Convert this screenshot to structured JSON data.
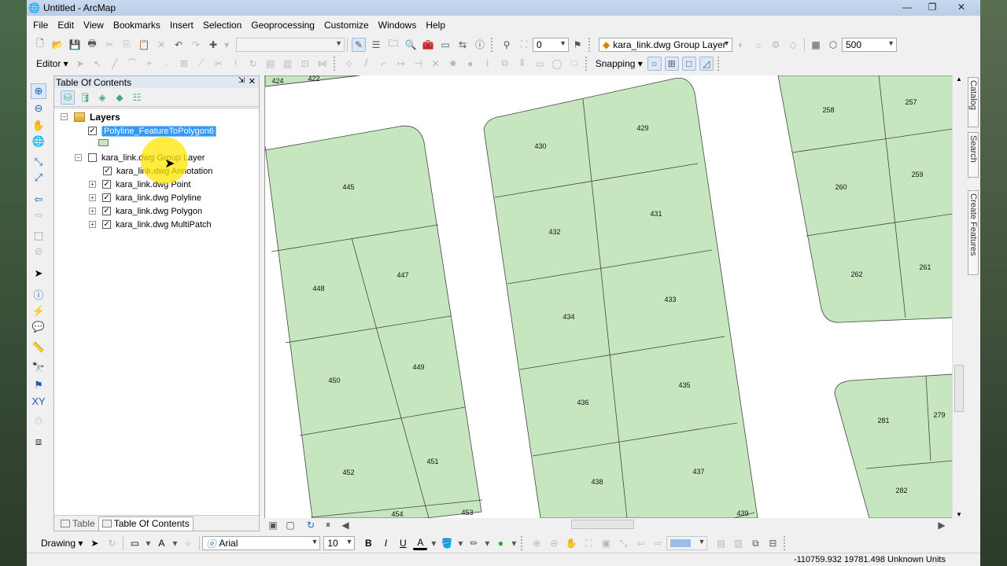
{
  "window": {
    "title": "Untitled - ArcMap",
    "minimize": "—",
    "maximize": "❐",
    "close": "✕"
  },
  "menu": [
    "File",
    "Edit",
    "View",
    "Bookmarks",
    "Insert",
    "Selection",
    "Geoprocessing",
    "Customize",
    "Windows",
    "Help"
  ],
  "toolbar1": {
    "layer_combo_value": "0",
    "active_layer": "kara_link.dwg Group Layer",
    "scale_value": "500"
  },
  "toolbar2": {
    "editor_label": "Editor ▾",
    "snapping_label": "Snapping ▾"
  },
  "toc": {
    "title": "Table Of Contents",
    "pin": "⇲",
    "close": "✕",
    "root_label": "Layers",
    "layers": [
      {
        "label": "Polyline_FeatureToPolygon6",
        "checked": true,
        "selected": true
      },
      {
        "label": "kara_link.dwg Group Layer",
        "checked": false
      },
      {
        "label": "kara_link.dwg Annotation",
        "checked": true
      },
      {
        "label": "kara_link.dwg Point",
        "checked": true
      },
      {
        "label": "kara_link.dwg Polyline",
        "checked": true
      },
      {
        "label": "kara_link.dwg Polygon",
        "checked": true
      },
      {
        "label": "kara_link.dwg MultiPatch",
        "checked": true
      }
    ],
    "tabs": {
      "table": "Table",
      "toc": "Table Of Contents"
    }
  },
  "map": {
    "fill_color": "#c6e6c0",
    "stroke_color": "#444444",
    "parcels": [
      "424",
      "422",
      "445",
      "448",
      "447",
      "450",
      "449",
      "452",
      "451",
      "454",
      "453",
      "430",
      "429",
      "432",
      "431",
      "434",
      "433",
      "436",
      "435",
      "438",
      "437",
      "439",
      "258",
      "257",
      "260",
      "259",
      "262",
      "261",
      "281",
      "279",
      "282"
    ]
  },
  "right_tabs": [
    "Catalog",
    "Search",
    "Create Features"
  ],
  "drawing": {
    "label": "Drawing ▾",
    "font": "Arial",
    "size": "10",
    "bold": "B",
    "italic": "I",
    "underline": "U",
    "font_color": "A"
  },
  "status": {
    "coords": "-110759.932  19781.498 Unknown Units"
  }
}
